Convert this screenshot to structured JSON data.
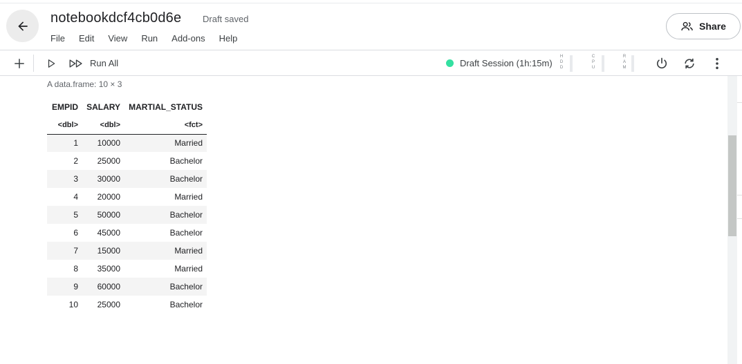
{
  "header": {
    "title": "notebookdcf4cb0d6e",
    "status": "Draft saved",
    "menu": [
      "File",
      "Edit",
      "View",
      "Run",
      "Add-ons",
      "Help"
    ],
    "share_label": "Share"
  },
  "toolbar": {
    "run_all_label": "Run All",
    "session_text": "Draft Session (1h:15m)",
    "session_color": "#34e0a1",
    "meters": [
      {
        "label": [
          "H",
          "D",
          "D"
        ]
      },
      {
        "label": [
          "C",
          "P",
          "U"
        ]
      },
      {
        "label": [
          "R",
          "A",
          "M"
        ]
      }
    ],
    "icons": [
      "add-icon",
      "run-cell-icon",
      "run-all-icon",
      "power-icon",
      "refresh-icon",
      "more-vert-icon"
    ]
  },
  "output": {
    "caption": "A data.frame: 10 × 3",
    "columns": [
      {
        "name": "EMPID",
        "type": "<dbl>"
      },
      {
        "name": "SALARY",
        "type": "<dbl>"
      },
      {
        "name": "MARTIAL_STATUS",
        "type": "<fct>"
      }
    ],
    "rows": [
      [
        "1",
        "10000",
        "Married"
      ],
      [
        "2",
        "25000",
        "Bachelor"
      ],
      [
        "3",
        "30000",
        "Bachelor"
      ],
      [
        "4",
        "20000",
        "Married"
      ],
      [
        "5",
        "50000",
        "Bachelor"
      ],
      [
        "6",
        "45000",
        "Bachelor"
      ],
      [
        "7",
        "15000",
        "Married"
      ],
      [
        "8",
        "35000",
        "Married"
      ],
      [
        "9",
        "60000",
        "Bachelor"
      ],
      [
        "10",
        "25000",
        "Bachelor"
      ]
    ]
  }
}
